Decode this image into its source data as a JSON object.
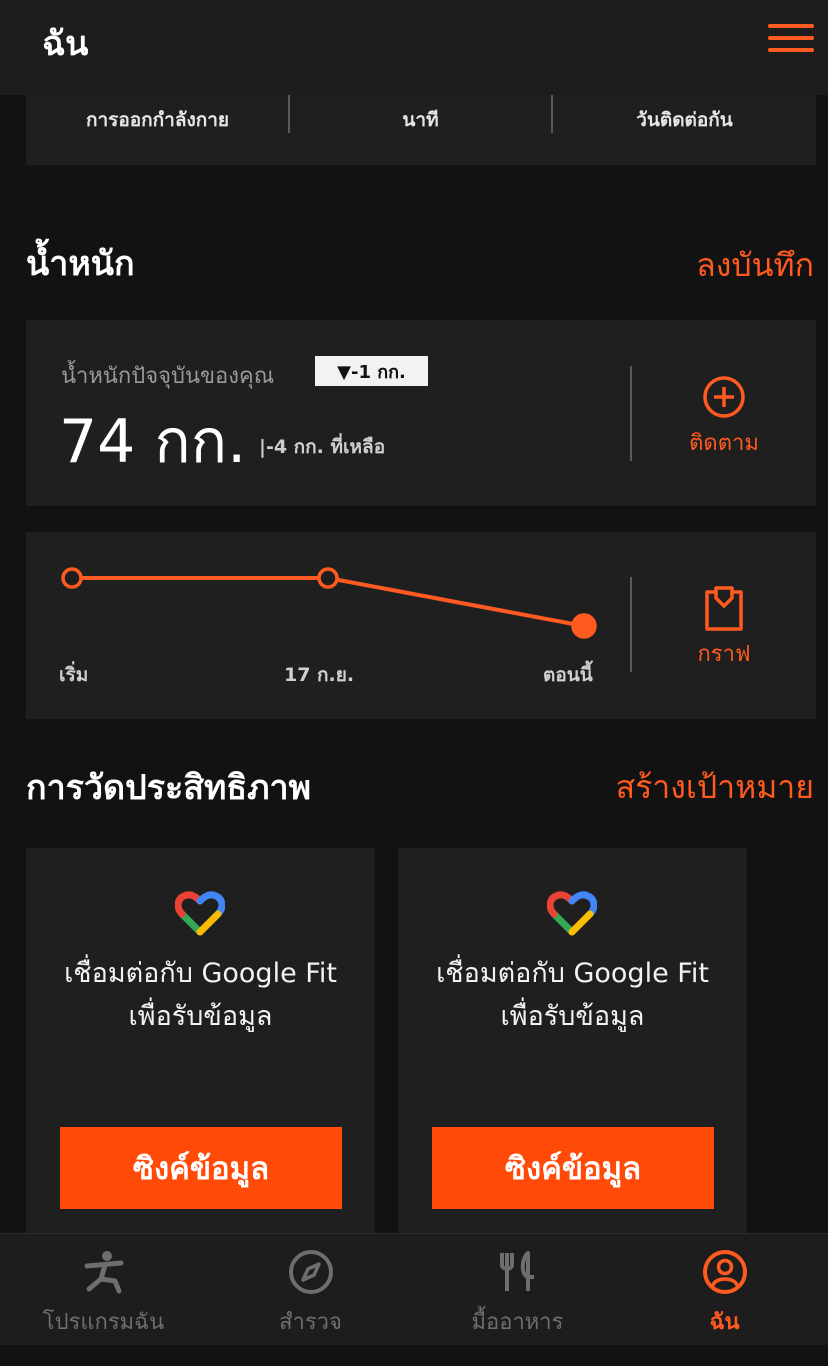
{
  "header": {
    "title": "ฉัน"
  },
  "stats": {
    "labels": [
      "การออกกำลังกาย",
      "นาที",
      "วันติดต่อกัน"
    ]
  },
  "weight_section": {
    "title": "น้ำหนัก",
    "action": "ลงบันทึก"
  },
  "weight_card": {
    "label": "น้ำหนักปัจจุบันของคุณ",
    "change_badge": "▼-1 กก.",
    "value": "74 กก.",
    "remaining": "-4 กก. ที่เหลือ",
    "track_label": "ติดตาม"
  },
  "weight_chart": {
    "x_labels": [
      "เริ่ม",
      "17 ก.ย.",
      "ตอนนี้"
    ],
    "graph_label": "กราฟ"
  },
  "chart_data": {
    "type": "line",
    "categories": [
      "เริ่ม",
      "17 ก.ย.",
      "ตอนนี้"
    ],
    "series": [
      {
        "values": [
          75,
          75,
          74
        ]
      }
    ]
  },
  "performance_section": {
    "title": "การวัดประสิทธิภาพ",
    "action": "สร้างเป้าหมาย"
  },
  "fit_cards": [
    {
      "text": "เชื่อมต่อกับ Google Fit เพื่อรับข้อมูล",
      "button": "ซิงค์ข้อมูล"
    },
    {
      "text": "เชื่อมต่อกับ Google Fit เพื่อรับข้อมูล",
      "button": "ซิงค์ข้อมูล"
    }
  ],
  "nav": {
    "items": [
      {
        "label": "โปรแกรมฉัน",
        "icon": "workout-icon"
      },
      {
        "label": "สำรวจ",
        "icon": "compass-icon"
      },
      {
        "label": "มื้ออาหาร",
        "icon": "fork-knife-icon"
      },
      {
        "label": "ฉัน",
        "icon": "profile-icon"
      }
    ],
    "active_index": 3
  },
  "colors": {
    "accent": "#ff5a1f",
    "button": "#ff4a08",
    "card": "#1f1f1f",
    "background": "#121212"
  }
}
